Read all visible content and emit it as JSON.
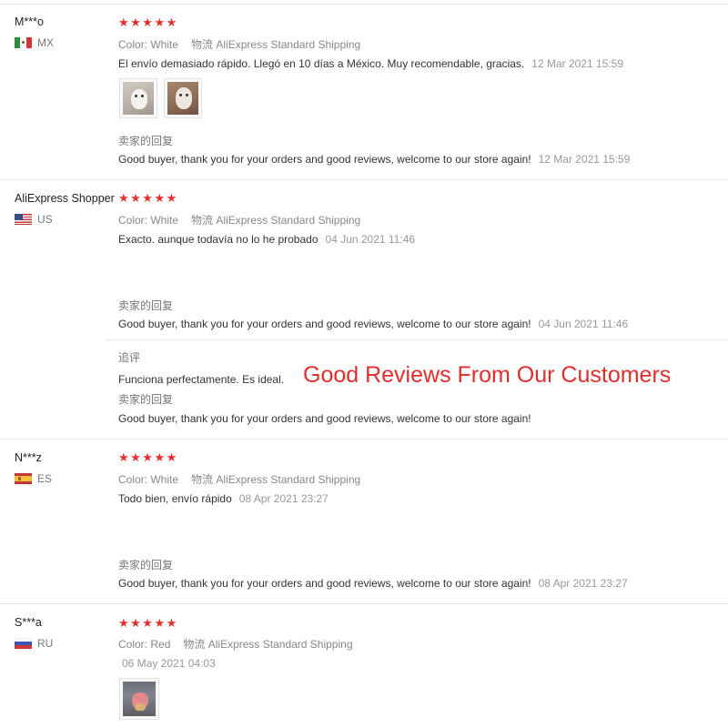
{
  "overlay_text": "Good Reviews From Our Customers",
  "colors": {
    "star": "#e62e2e",
    "overlay": "#e22d2d",
    "muted": "#888888",
    "divider": "#e8e8e8"
  },
  "labels": {
    "color": "Color:",
    "logistics": "物流",
    "seller_reply": "卖家的回复",
    "followup": "追评"
  },
  "reviews": [
    {
      "user": "M***o",
      "country": "MX",
      "flag_icon": "mexico-flag-icon",
      "stars": "★★★★★",
      "color": "White",
      "shipping": "AliExpress Standard Shipping",
      "text": "El envío demasiado rápido. Llegó en 10 días a México. Muy recomendable, gracias.",
      "date": "12 Mar 2021 15:59",
      "images": [
        "bear-toy-photo",
        "bear-toy-photo"
      ],
      "reply": "Good buyer, thank you for your orders and good reviews, welcome to our store again!",
      "reply_date": "12 Mar 2021 15:59"
    },
    {
      "user": "AliExpress Shopper",
      "country": "US",
      "flag_icon": "usa-flag-icon",
      "stars": "★★★★★",
      "color": "White",
      "shipping": "AliExpress Standard Shipping",
      "text": "Exacto. aunque todavía no lo he probado",
      "date": "04 Jun 2021 11:46",
      "reply": "Good buyer, thank you for your orders and good reviews, welcome to our store again!",
      "reply_date": "04 Jun 2021 11:46",
      "followup_text": "Funciona perfectamente. Es ideal.",
      "followup_reply": "Good buyer, thank you for your orders and good reviews, welcome to our store again!"
    },
    {
      "user": "N***z",
      "country": "ES",
      "flag_icon": "spain-flag-icon",
      "stars": "★★★★★",
      "color": "White",
      "shipping": "AliExpress Standard Shipping",
      "text": "Todo bien, envío rápido",
      "date": "08 Apr 2021 23:27",
      "reply": "Good buyer, thank you for your orders and good reviews, welcome to our store again!",
      "reply_date": "08 Apr 2021 23:27"
    },
    {
      "user": "S***a",
      "country": "RU",
      "flag_icon": "russia-flag-icon",
      "stars": "★★★★★",
      "color": "Red",
      "shipping": "AliExpress Standard Shipping",
      "date": "06 May 2021 04:03",
      "images": [
        "pink-toy-photo"
      ]
    }
  ]
}
